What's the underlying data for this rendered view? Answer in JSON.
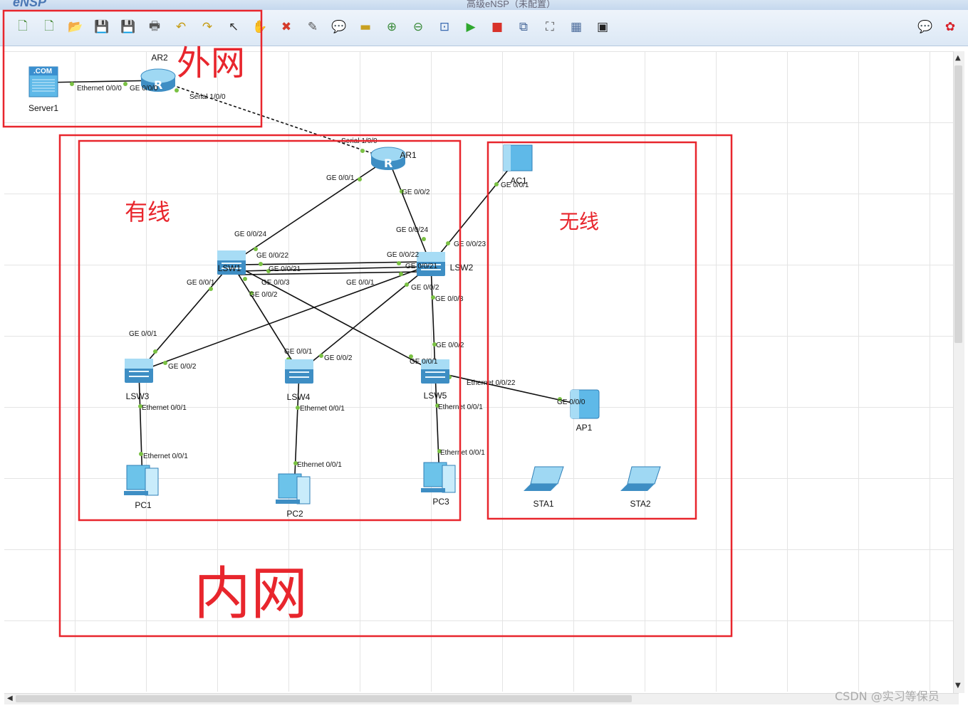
{
  "window": {
    "app_name": "eNSP",
    "title": "高级eNSP（未配置）"
  },
  "colors": {
    "annotation": "#e8262d",
    "link": "#111111",
    "port_dot": "#7ac143",
    "device": "#5fb9e8"
  },
  "toolbar": {
    "buttons": [
      {
        "name": "new-topology-icon",
        "glyph": "🗋",
        "color": "#4a8b3a"
      },
      {
        "name": "new-example-icon",
        "glyph": "🗋",
        "color": "#4a8b3a"
      },
      {
        "name": "open-icon",
        "glyph": "📂",
        "color": "#d79b2e"
      },
      {
        "name": "save-icon",
        "glyph": "💾",
        "color": "#4b6ea8"
      },
      {
        "name": "save-as-icon",
        "glyph": "💾",
        "color": "#c88a2a"
      },
      {
        "name": "print-icon",
        "glyph": "🖶",
        "color": "#555"
      },
      {
        "name": "undo-icon",
        "glyph": "↶",
        "color": "#c49a10"
      },
      {
        "name": "redo-icon",
        "glyph": "↷",
        "color": "#c49a10"
      },
      {
        "name": "select-icon",
        "glyph": "↖",
        "color": "#333"
      },
      {
        "name": "drag-hand-icon",
        "glyph": "✋",
        "color": "#e08a1e"
      },
      {
        "name": "delete-icon",
        "glyph": "✖",
        "color": "#d43a2a"
      },
      {
        "name": "delete-link-icon",
        "glyph": "✎",
        "color": "#555"
      },
      {
        "name": "text-note-icon",
        "glyph": "💬",
        "color": "#5a9a3a"
      },
      {
        "name": "palette-icon",
        "glyph": "▬",
        "color": "#c8a020"
      },
      {
        "name": "zoom-in-icon",
        "glyph": "⊕",
        "color": "#3a8a3a"
      },
      {
        "name": "zoom-out-icon",
        "glyph": "⊖",
        "color": "#3a8a3a"
      },
      {
        "name": "fit-view-icon",
        "glyph": "⊡",
        "color": "#3a6ab0"
      },
      {
        "name": "start-device-icon",
        "glyph": "▶",
        "color": "#2fa82f"
      },
      {
        "name": "stop-device-icon",
        "glyph": "■",
        "color": "#d8322a"
      },
      {
        "name": "capture-icon",
        "glyph": "⧉",
        "color": "#4a6a9a"
      },
      {
        "name": "topology-icon",
        "glyph": "⛶",
        "color": "#555"
      },
      {
        "name": "grid-icon",
        "glyph": "▦",
        "color": "#4a6a9a"
      },
      {
        "name": "screenshot-icon",
        "glyph": "▣",
        "color": "#222"
      },
      {
        "name": "feedback-icon",
        "glyph": "💬",
        "color": "#4a6a9a"
      },
      {
        "name": "huawei-logo-icon",
        "glyph": "✿",
        "color": "#d8222a"
      }
    ]
  },
  "topology": {
    "devices": [
      {
        "id": "Server1",
        "label": "Server1"
      },
      {
        "id": "AR2",
        "label": "AR2"
      },
      {
        "id": "AR1",
        "label": "AR1"
      },
      {
        "id": "AC1",
        "label": "AC1"
      },
      {
        "id": "LSW1",
        "label": "LSW1"
      },
      {
        "id": "LSW2",
        "label": "LSW2"
      },
      {
        "id": "LSW3",
        "label": "LSW3"
      },
      {
        "id": "LSW4",
        "label": "LSW4"
      },
      {
        "id": "LSW5",
        "label": "LSW5"
      },
      {
        "id": "AP1",
        "label": "AP1"
      },
      {
        "id": "PC1",
        "label": "PC1"
      },
      {
        "id": "PC2",
        "label": "PC2"
      },
      {
        "id": "PC3",
        "label": "PC3"
      },
      {
        "id": "STA1",
        "label": "STA1"
      },
      {
        "id": "STA2",
        "label": "STA2"
      }
    ],
    "port_labels": [
      "Ethernet 0/0/0",
      "GE 0/0/0",
      "Serial 1/0/0",
      "Serial 1/0/0",
      "GE 0/0/1",
      "GE 0/0/2",
      "GE 0/0/1",
      "GE 0/0/24",
      "GE 0/0/24",
      "GE 0/0/23",
      "GE 0/0/22",
      "GE 0/0/22",
      "GE 0/0/21",
      "GE 0/0/21",
      "GE 0/0/3",
      "GE 0/0/2",
      "GE 0/0/1",
      "GE 0/0/1",
      "GE 0/0/2",
      "GE 0/0/3",
      "GE 0/0/1",
      "GE 0/0/2",
      "GE 0/0/1",
      "GE 0/0/2",
      "GE 0/0/2",
      "GE 0/0/1",
      "Ethernet 0/0/22",
      "GE 0/0/0",
      "Ethernet 0/0/1",
      "Ethernet 0/0/1",
      "Ethernet 0/0/1",
      "Ethernet 0/0/1",
      "Ethernet 0/0/1",
      "Ethernet 0/0/1"
    ],
    "zones": [
      "外网",
      "有线",
      "无线",
      "内网"
    ]
  },
  "watermark": "CSDN @实习等保员"
}
